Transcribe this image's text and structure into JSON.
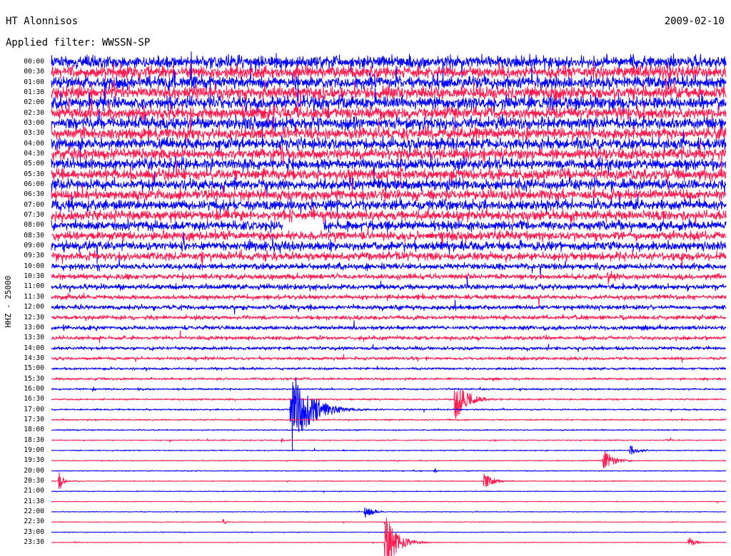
{
  "chart_data": {
    "type": "line",
    "title": "HT Alonnisos",
    "date": "2009-02-10",
    "filter": "Applied filter: WWSSN-SP",
    "ylabel": "HHZ - 25000",
    "xlabel": "",
    "xlim": [
      0,
      30
    ],
    "grid": false,
    "series": [
      {
        "name": "00:00",
        "color": "#0000ff",
        "noise": 16000,
        "events": []
      },
      {
        "name": "00:30",
        "color": "#ff1a4f",
        "noise": 16000,
        "events": []
      },
      {
        "name": "01:00",
        "color": "#0000ff",
        "noise": 16000,
        "events": []
      },
      {
        "name": "01:30",
        "color": "#ff1a4f",
        "noise": 16500,
        "events": []
      },
      {
        "name": "02:00",
        "color": "#0000ff",
        "noise": 16500,
        "events": []
      },
      {
        "name": "02:30",
        "color": "#ff1a4f",
        "noise": 16000,
        "events": []
      },
      {
        "name": "03:00",
        "color": "#0000ff",
        "noise": 16000,
        "events": []
      },
      {
        "name": "03:30",
        "color": "#ff1a4f",
        "noise": 15500,
        "events": []
      },
      {
        "name": "04:00",
        "color": "#0000ff",
        "noise": 15000,
        "events": []
      },
      {
        "name": "04:30",
        "color": "#ff1a4f",
        "noise": 15000,
        "events": []
      },
      {
        "name": "05:00",
        "color": "#0000ff",
        "noise": 14500,
        "events": []
      },
      {
        "name": "05:30",
        "color": "#ff1a4f",
        "noise": 14500,
        "events": []
      },
      {
        "name": "06:00",
        "color": "#0000ff",
        "noise": 14000,
        "events": []
      },
      {
        "name": "06:30",
        "color": "#ff1a4f",
        "noise": 14000,
        "events": []
      },
      {
        "name": "07:00",
        "color": "#0000ff",
        "noise": 13500,
        "events": []
      },
      {
        "name": "07:30",
        "color": "#ff1a4f",
        "noise": 13500,
        "events": []
      },
      {
        "name": "08:00",
        "color": "#0000ff",
        "noise": 12500,
        "events": [],
        "gaps": [
          [
            10.3,
            12.1
          ]
        ]
      },
      {
        "name": "08:30",
        "color": "#ff1a4f",
        "noise": 12000,
        "events": []
      },
      {
        "name": "09:00",
        "color": "#0000ff",
        "noise": 11500,
        "events": []
      },
      {
        "name": "09:30",
        "color": "#ff1a4f",
        "noise": 11000,
        "events": []
      },
      {
        "name": "10:00",
        "color": "#0000ff",
        "noise": 8000,
        "events": []
      },
      {
        "name": "10:30",
        "color": "#ff1a4f",
        "noise": 7500,
        "events": [
          {
            "t": 24.7,
            "amp": 19000,
            "dur": 0.8
          }
        ]
      },
      {
        "name": "11:00",
        "color": "#0000ff",
        "noise": 7000,
        "events": []
      },
      {
        "name": "11:30",
        "color": "#ff1a4f",
        "noise": 6000,
        "events": []
      },
      {
        "name": "12:00",
        "color": "#0000ff",
        "noise": 6000,
        "events": []
      },
      {
        "name": "12:30",
        "color": "#ff1a4f",
        "noise": 5500,
        "events": []
      },
      {
        "name": "13:00",
        "color": "#0000ff",
        "noise": 5500,
        "events": []
      },
      {
        "name": "13:30",
        "color": "#ff1a4f",
        "noise": 5000,
        "events": []
      },
      {
        "name": "14:00",
        "color": "#0000ff",
        "noise": 4500,
        "events": []
      },
      {
        "name": "14:30",
        "color": "#ff1a4f",
        "noise": 4000,
        "events": []
      },
      {
        "name": "15:00",
        "color": "#0000ff",
        "noise": 3200,
        "events": []
      },
      {
        "name": "15:30",
        "color": "#ff1a4f",
        "noise": 3000,
        "events": [
          {
            "t": 19.6,
            "amp": 7000,
            "dur": 0.6
          }
        ]
      },
      {
        "name": "16:00",
        "color": "#0000ff",
        "noise": 2400,
        "events": [
          {
            "t": 1.8,
            "amp": 4500,
            "dur": 0.4
          },
          {
            "t": 3.8,
            "amp": 4500,
            "dur": 0.4
          },
          {
            "t": 29.0,
            "amp": 4000,
            "dur": 0.3
          }
        ]
      },
      {
        "name": "16:30",
        "color": "#ff1a4f",
        "noise": 2200,
        "events": [
          {
            "t": 17.9,
            "amp": 61000,
            "dur": 1.2
          }
        ]
      },
      {
        "name": "17:00",
        "color": "#0000ff",
        "noise": 2000,
        "events": [
          {
            "t": 10.6,
            "amp": 110000,
            "dur": 2.0
          }
        ]
      },
      {
        "name": "17:30",
        "color": "#ff1a4f",
        "noise": 1800,
        "events": []
      },
      {
        "name": "18:00",
        "color": "#0000ff",
        "noise": 1600,
        "events": []
      },
      {
        "name": "18:30",
        "color": "#ff1a4f",
        "noise": 1500,
        "events": [
          {
            "t": 10.2,
            "amp": 6000,
            "dur": 0.4
          },
          {
            "t": 27.3,
            "amp": 4000,
            "dur": 0.3
          }
        ]
      },
      {
        "name": "19:00",
        "color": "#0000ff",
        "noise": 1400,
        "events": [
          {
            "t": 25.7,
            "amp": 16000,
            "dur": 0.8
          }
        ]
      },
      {
        "name": "19:30",
        "color": "#ff1a4f",
        "noise": 1300,
        "events": [
          {
            "t": 24.5,
            "amp": 31000,
            "dur": 1.0
          }
        ]
      },
      {
        "name": "20:00",
        "color": "#0000ff",
        "noise": 1200,
        "events": [
          {
            "t": 17.0,
            "amp": 6000,
            "dur": 0.3
          }
        ]
      },
      {
        "name": "20:30",
        "color": "#ff1a4f",
        "noise": 1100,
        "events": [
          {
            "t": 0.3,
            "amp": 28000,
            "dur": 0.4
          },
          {
            "t": 19.2,
            "amp": 20000,
            "dur": 1.0
          }
        ]
      },
      {
        "name": "21:00",
        "color": "#0000ff",
        "noise": 1100,
        "events": []
      },
      {
        "name": "21:30",
        "color": "#ff1a4f",
        "noise": 1000,
        "events": []
      },
      {
        "name": "22:00",
        "color": "#0000ff",
        "noise": 1000,
        "events": [
          {
            "t": 13.9,
            "amp": 17000,
            "dur": 0.8
          }
        ]
      },
      {
        "name": "22:30",
        "color": "#ff1a4f",
        "noise": 1000,
        "events": [
          {
            "t": 7.6,
            "amp": 8000,
            "dur": 0.3
          }
        ]
      },
      {
        "name": "23:00",
        "color": "#0000ff",
        "noise": 1000,
        "events": []
      },
      {
        "name": "23:30",
        "color": "#ff1a4f",
        "noise": 1000,
        "events": [
          {
            "t": 1.0,
            "amp": 4000,
            "dur": 0.3
          },
          {
            "t": 14.8,
            "amp": 80000,
            "dur": 1.2
          },
          {
            "t": 28.3,
            "amp": 16000,
            "dur": 0.6
          }
        ]
      }
    ]
  }
}
